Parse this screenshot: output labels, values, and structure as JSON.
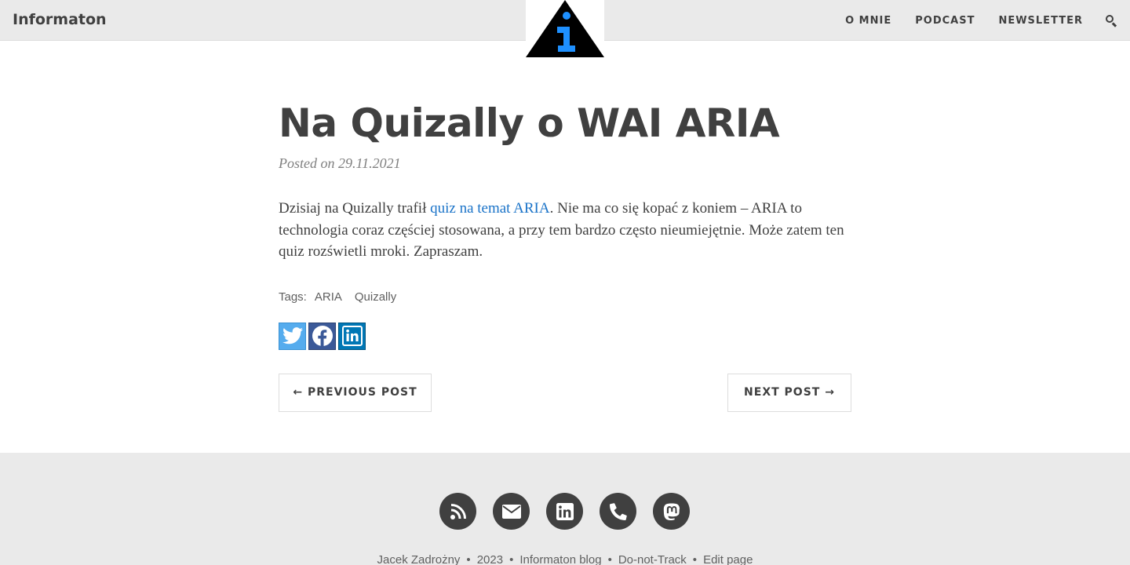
{
  "navbar": {
    "brand": "Informaton",
    "links": [
      "O MNIE",
      "PODCAST",
      "NEWSLETTER"
    ],
    "search_icon": "search-icon"
  },
  "logo": {
    "letter": "i",
    "colors": {
      "triangle": "#000000",
      "letter": "#1e90ff"
    }
  },
  "post": {
    "title": "Na Quizally o WAI ARIA",
    "meta": "Posted on 29.11.2021",
    "body_before_link": "Dzisiaj na Quizally trafił ",
    "body_link": "quiz na temat ARIA",
    "body_after_link": ". Nie ma co się kopać z koniem – ARIA to technologia coraz częściej stosowana, a przy tem bardzo często nieumiejętnie. Może zatem ten quiz rozświetli mroki. Zapraszam.",
    "tags_label": "Tags:",
    "tags": [
      "ARIA",
      "Quizally"
    ],
    "share": [
      "twitter-icon",
      "facebook-icon",
      "linkedin-icon"
    ]
  },
  "pager": {
    "prev": "← PREVIOUS POST",
    "next": "NEXT POST →"
  },
  "footer": {
    "icons": [
      "rss-icon",
      "email-icon",
      "linkedin-icon",
      "phone-icon",
      "mastodon-icon"
    ],
    "items": [
      "Jacek Zadrożny",
      "2023",
      "Informaton blog",
      "Do-not-Track",
      "Edit page"
    ],
    "separator": "•"
  },
  "colors": {
    "navbar_bg": "#eaeaea",
    "text": "#404040",
    "link": "#1a73c8",
    "twitter": "#55acee",
    "facebook": "#3b5998",
    "linkedin": "#0077b5"
  }
}
